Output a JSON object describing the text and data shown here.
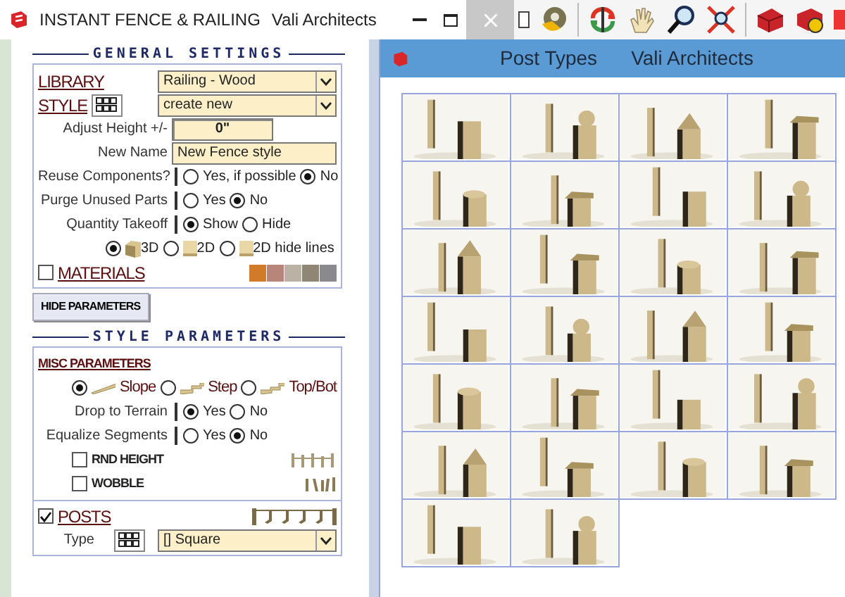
{
  "window": {
    "title": "INSTANT FENCE & RAILING",
    "company": "Vali Architects"
  },
  "general_settings": {
    "heading": "GENERAL SETTINGS",
    "library": {
      "label": "LIBRARY",
      "value": "Railing - Wood"
    },
    "style": {
      "label": "STYLE",
      "value": "create new"
    },
    "adjust_height": {
      "label": "Adjust Height +/-",
      "value": "0\""
    },
    "new_name": {
      "label": "New Name",
      "value": "New Fence style"
    },
    "options": [
      {
        "label": "Reuse Components?",
        "choices": [
          {
            "label": "Yes, if possible",
            "selected": false
          },
          {
            "label": "No",
            "selected": true
          }
        ]
      },
      {
        "label": "Purge Unused Parts",
        "choices": [
          {
            "label": "Yes",
            "selected": false
          },
          {
            "label": "No",
            "selected": true
          }
        ]
      },
      {
        "label": "Quantity Takeoff",
        "choices": [
          {
            "label": "Show",
            "selected": true
          },
          {
            "label": "Hide",
            "selected": false
          }
        ]
      }
    ],
    "view_modes": [
      {
        "kind": "cube",
        "label": "3D",
        "selected": true
      },
      {
        "kind": "flat",
        "label": "2D",
        "selected": false
      },
      {
        "kind": "flat",
        "label": "2D hide lines",
        "selected": false
      }
    ],
    "materials": {
      "label": "MATERIALS",
      "checked": false
    }
  },
  "hide_button": "HIDE PARAMETERS",
  "style_parameters": {
    "heading": "STYLE PARAMETERS",
    "misc": {
      "label": "MISC PARAMETERS",
      "modes": [
        {
          "kind": "slope",
          "label": "Slope",
          "selected": true
        },
        {
          "kind": "step",
          "label": "Step",
          "selected": false
        },
        {
          "kind": "topbot",
          "label": "Top/Bot",
          "selected": false
        }
      ],
      "options": [
        {
          "label": "Drop to Terrain",
          "choices": [
            {
              "label": "Yes",
              "selected": true
            },
            {
              "label": "No",
              "selected": false
            }
          ]
        },
        {
          "label": "Equalize Segments",
          "choices": [
            {
              "label": "Yes",
              "selected": false
            },
            {
              "label": "No",
              "selected": true
            }
          ]
        }
      ],
      "toggles": [
        {
          "kind": "rnd",
          "label": "RND HEIGHT",
          "checked": false
        },
        {
          "kind": "wobble",
          "label": "WOBBLE",
          "checked": false
        }
      ]
    },
    "posts": {
      "label": "POSTS",
      "checked": true,
      "type_label": "Type",
      "type_value": "[] Square"
    }
  },
  "post_types": {
    "title": "Post Types",
    "company": "Vali Architects"
  }
}
